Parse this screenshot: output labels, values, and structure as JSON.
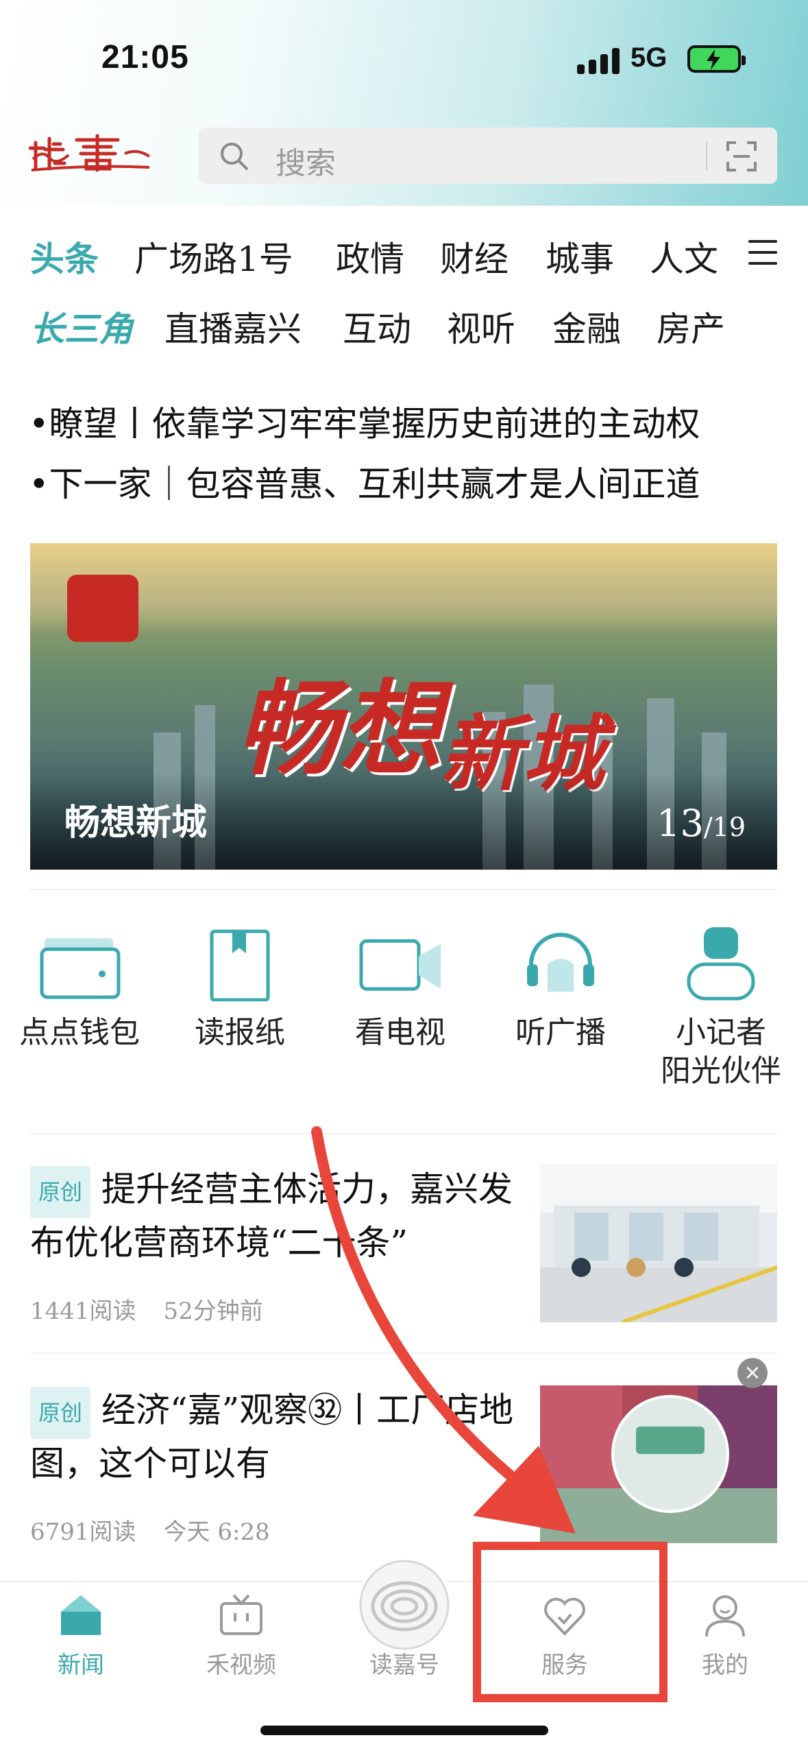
{
  "status_bar": {
    "time": "21:05",
    "network": "5G"
  },
  "search": {
    "placeholder": "搜索"
  },
  "nav": {
    "row1": [
      "头条",
      "广场路1号",
      "政情",
      "财经",
      "城事",
      "人文"
    ],
    "row2_brand": "长三角",
    "row2": [
      "直播嘉兴",
      "互动",
      "视听",
      "金融",
      "房产"
    ]
  },
  "headlines": [
    "•瞭望丨依靠学习牢牢掌握历史前进的主动权",
    "•下一家｜包容普惠、互利共赢才是人间正道"
  ],
  "banner": {
    "caption": "畅想新城",
    "art_title_1": "畅想",
    "art_title_2": "新城",
    "page_current": "13",
    "page_total": "/19"
  },
  "services": [
    "点点钱包",
    "读报纸",
    "看电视",
    "听广播",
    "小记者阳光伙伴"
  ],
  "services_lines": {
    "last_line1": "小记者",
    "last_line2": "阳光伙伴"
  },
  "news": [
    {
      "tag": "原创",
      "title": "提升经营主体活力，嘉兴发布优化营商环境“二十条”",
      "reads": "1441阅读",
      "time": "52分钟前"
    },
    {
      "tag": "原创",
      "title": "经济“嘉”观察㉜丨工厂店地图，这个可以有",
      "reads": "6791阅读",
      "time": "今天 6:28"
    }
  ],
  "tabbar": {
    "items": [
      "新闻",
      "禾视频",
      "读嘉号",
      "服务",
      "我的"
    ],
    "active": "新闻"
  },
  "colors": {
    "accent": "#3aa9ad",
    "annotation": "#e8463a"
  }
}
